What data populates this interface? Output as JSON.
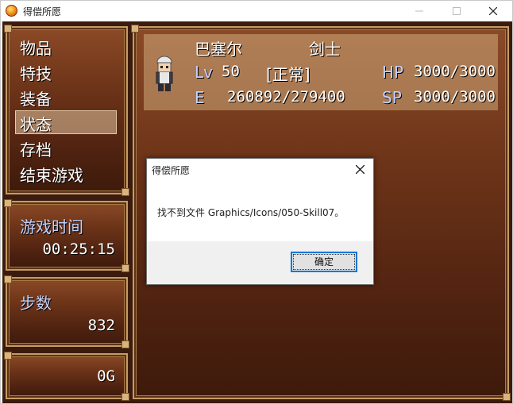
{
  "window": {
    "title": "得偿所愿",
    "minimize_icon": "minimize-icon",
    "maximize_icon": "maximize-icon",
    "close_icon": "close-icon"
  },
  "menu": {
    "items": [
      "物品",
      "特技",
      "装备",
      "状态",
      "存档",
      "结束游戏"
    ],
    "selected": "状态"
  },
  "play_time": {
    "label": "游戏时间",
    "value": "00:25:15"
  },
  "steps": {
    "label": "步数",
    "value": "832"
  },
  "gold": {
    "value": "0G"
  },
  "actor": {
    "name": "巴塞尔",
    "class": "剑士",
    "level_label": "Lv",
    "level": "50",
    "state": "[正常]",
    "hp_label": "HP",
    "hp": "3000/3000",
    "exp_label": "E",
    "exp": "260892/279400",
    "sp_label": "SP",
    "sp": "3000/3000"
  },
  "dialog": {
    "title": "得偿所愿",
    "message": "找不到文件 Graphics/Icons/050-Skill07。",
    "ok_label": "确定"
  },
  "colors": {
    "system_text": "#c1d2ff",
    "normal_text": "#ffffff",
    "accent_button_border": "#0078d7"
  }
}
